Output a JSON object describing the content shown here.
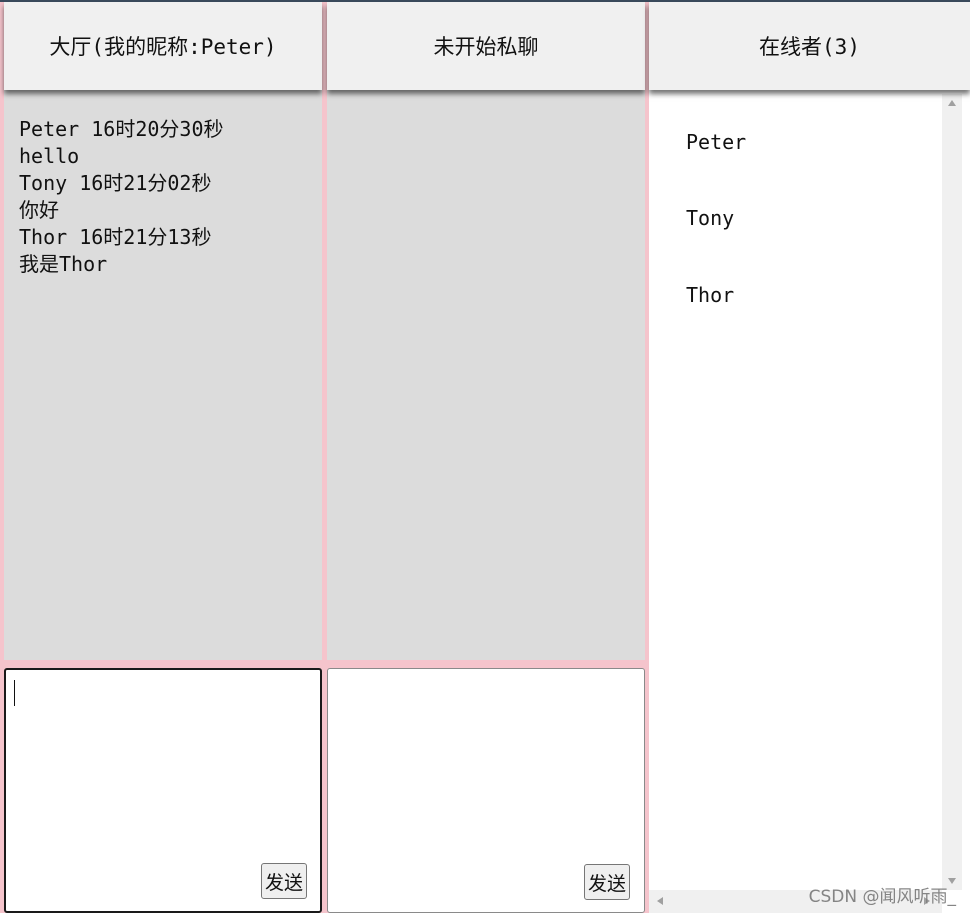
{
  "lobby": {
    "title": "大厅(我的昵称:Peter)",
    "messages": [
      {
        "header": "Peter 16时20分30秒",
        "text": "hello"
      },
      {
        "header": "Tony 16时21分02秒",
        "text": "你好"
      },
      {
        "header": "Thor 16时21分13秒",
        "text": "我是Thor"
      }
    ],
    "input_value": "",
    "send_label": "发送"
  },
  "private_chat": {
    "title": "未开始私聊",
    "input_value": "",
    "send_label": "发送"
  },
  "online": {
    "title": "在线者(3)",
    "users": [
      "Peter",
      "Tony",
      "Thor"
    ]
  },
  "watermark": "CSDN @闻风听雨_",
  "colors": {
    "divider": "#ffc8d0",
    "header_bg": "#f0f0f0",
    "messages_bg": "#dcdcdc"
  }
}
